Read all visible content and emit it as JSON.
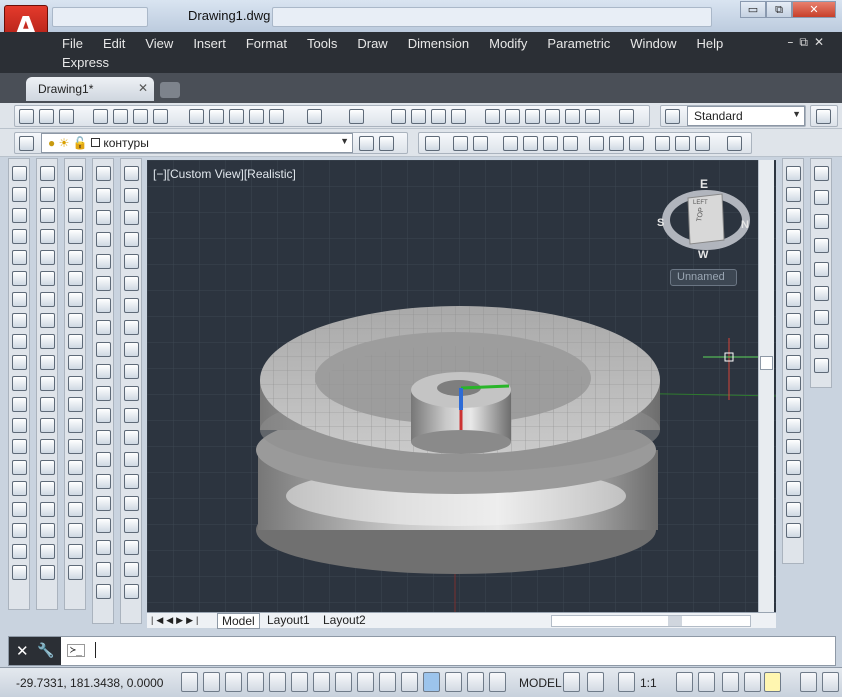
{
  "app": {
    "logo_letter": "A",
    "title": "Drawing1.dwg",
    "accent": "#c4281c"
  },
  "window_buttons": {
    "minimize": "▭",
    "restore": "⧉",
    "close": "✕"
  },
  "menu": [
    "File",
    "Edit",
    "View",
    "Insert",
    "Format",
    "Tools",
    "Draw",
    "Dimension",
    "Modify",
    "Parametric",
    "Window",
    "Help",
    "Express"
  ],
  "doc_tabs": [
    {
      "label": "Drawing1*",
      "close": "✕"
    }
  ],
  "toolbar": {
    "text_style": "Standard",
    "layer": "контуры"
  },
  "viewport": {
    "label": "[−][Custom View][Realistic]",
    "viewcube": {
      "top": "TOP",
      "left": "LEFT",
      "north": "N",
      "south": "S",
      "east": "E",
      "west": "W"
    },
    "ucs_menu": "Unnamed"
  },
  "layout_tabs": [
    "Model",
    "Layout1",
    "Layout2"
  ],
  "command": {
    "prompt_icon": "≻_"
  },
  "status": {
    "coordinates": "-29.7331, 181.3438, 0.0000",
    "model": "MODEL",
    "scale": "1:1"
  }
}
